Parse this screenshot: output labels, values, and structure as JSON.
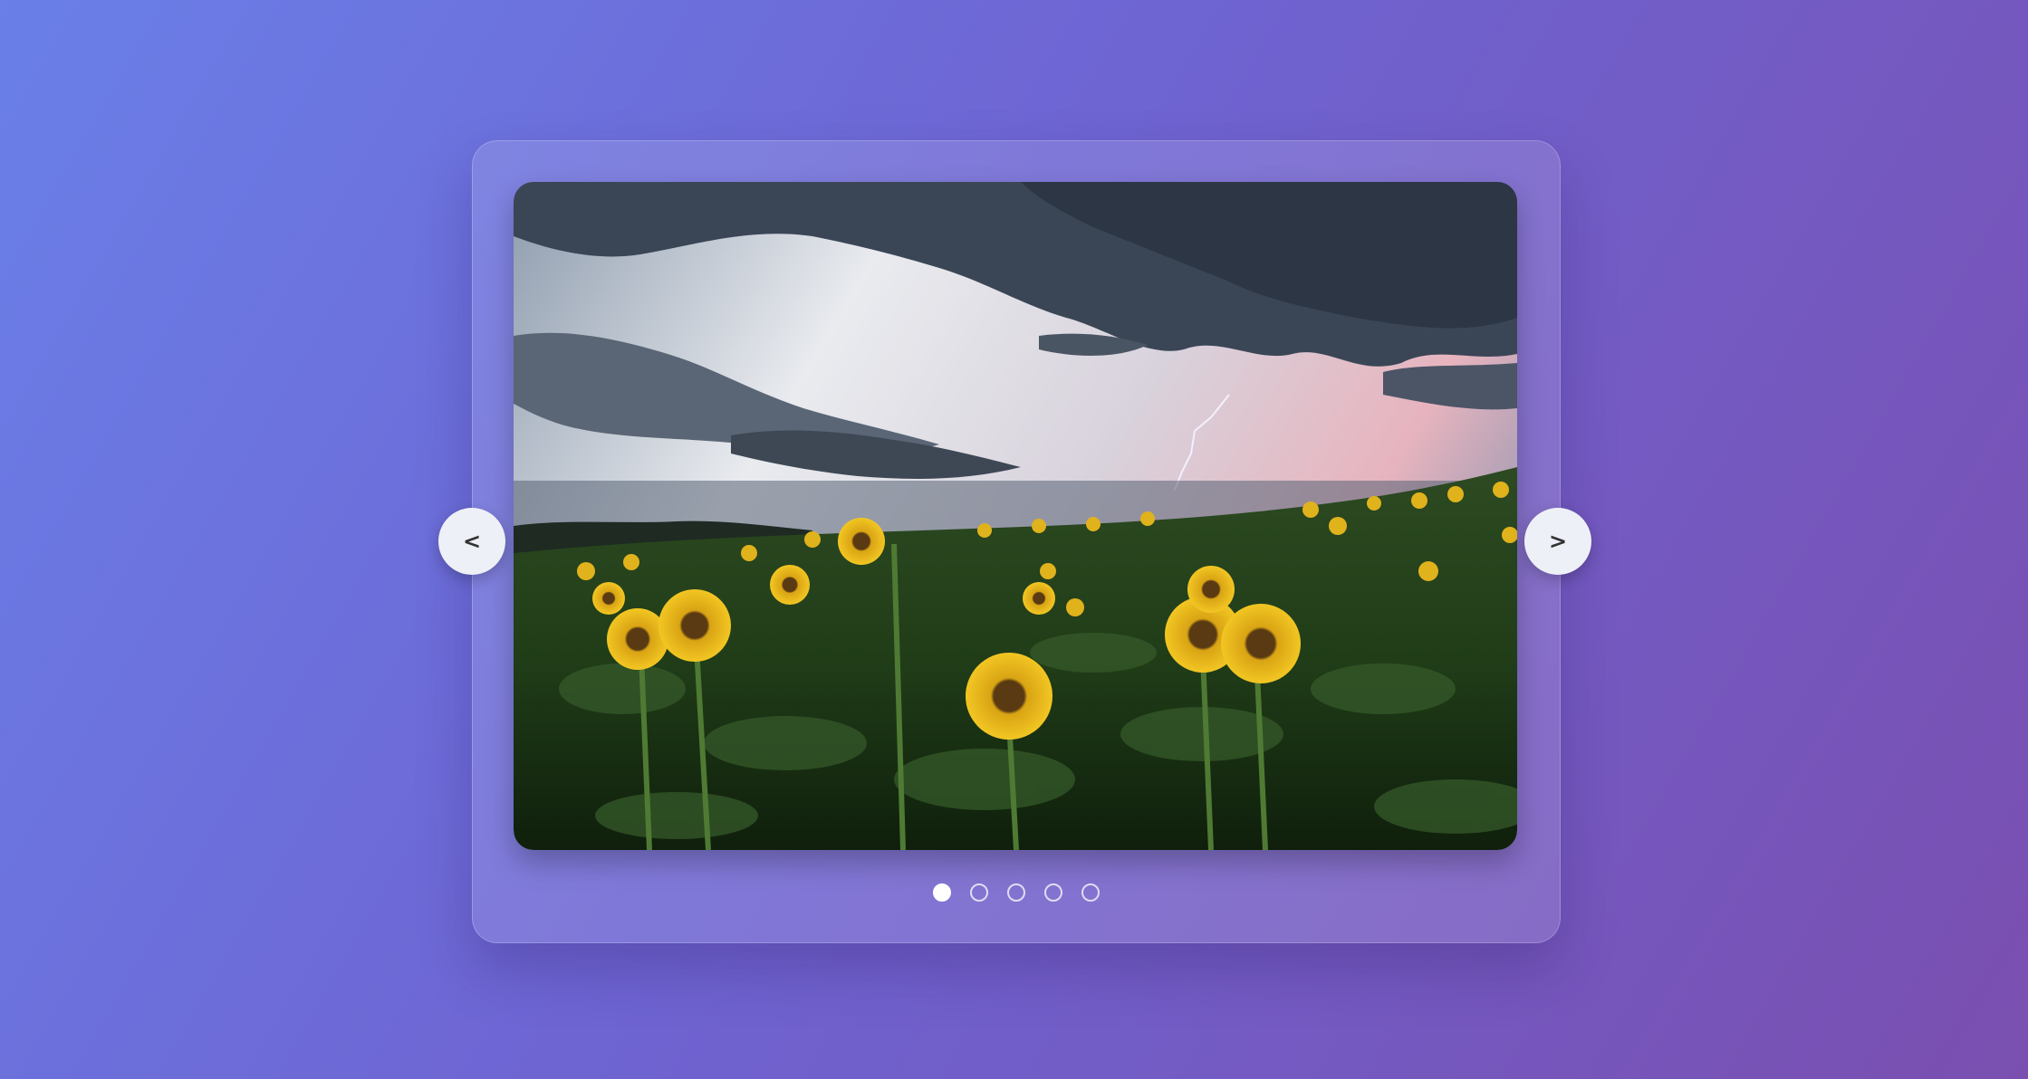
{
  "carousel": {
    "prev_label": "<",
    "next_label": ">",
    "slides": [
      {
        "image": "sunflower-field-under-stormy-sky-with-lightning",
        "active": true
      },
      {
        "image": "",
        "active": false
      },
      {
        "image": "",
        "active": false
      },
      {
        "image": "",
        "active": false
      },
      {
        "image": "",
        "active": false
      }
    ],
    "current_index": 1,
    "total": 5
  },
  "colors": {
    "background_start": "#6a7fe8",
    "background_end": "#7a4fb0",
    "button_bg": "#eef0f7",
    "dot_active": "#ffffff"
  }
}
